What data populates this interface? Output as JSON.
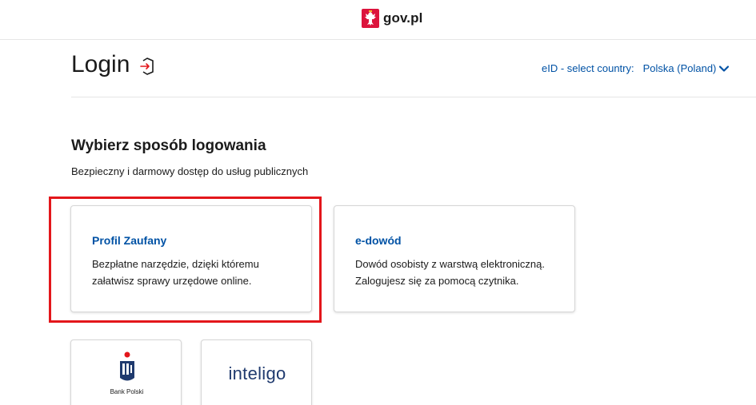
{
  "header": {
    "brand_text": "gov.pl"
  },
  "login": {
    "title": "Login",
    "eid_label": "eID - select country:",
    "country_selected": "Polska (Poland)"
  },
  "main": {
    "heading": "Wybierz sposób logowania",
    "subheading": "Bezpieczny i darmowy dostęp do usług publicznych"
  },
  "methods": [
    {
      "title": "Profil Zaufany",
      "desc_line1": "Bezpłatne narzędzie, dzięki któremu",
      "desc_line2": "załatwisz sprawy urzędowe online."
    },
    {
      "title": "e-dowód",
      "desc_line1": "Dowód osobisty z warstwą elektroniczną.",
      "desc_line2": "Zalogujesz się za pomocą czytnika."
    }
  ],
  "banks": [
    {
      "logo_text": "Bank Polski",
      "icon": "pko-logo-icon"
    },
    {
      "logo_text": "inteligo",
      "icon": "inteligo-logo-icon"
    }
  ],
  "colors": {
    "link_blue": "#0052a5",
    "highlight_red": "#e3161b",
    "border_gray": "#d6d6d6"
  }
}
